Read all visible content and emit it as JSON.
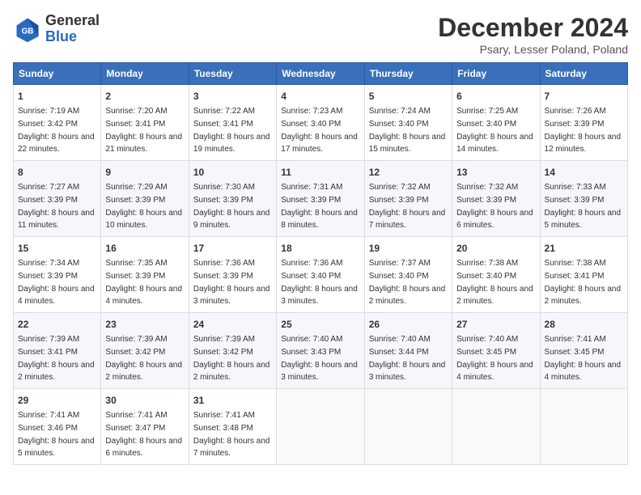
{
  "header": {
    "logo_general": "General",
    "logo_blue": "Blue",
    "month": "December 2024",
    "location": "Psary, Lesser Poland, Poland"
  },
  "weekdays": [
    "Sunday",
    "Monday",
    "Tuesday",
    "Wednesday",
    "Thursday",
    "Friday",
    "Saturday"
  ],
  "weeks": [
    [
      {
        "day": "1",
        "sunrise": "Sunrise: 7:19 AM",
        "sunset": "Sunset: 3:42 PM",
        "daylight": "Daylight: 8 hours and 22 minutes."
      },
      {
        "day": "2",
        "sunrise": "Sunrise: 7:20 AM",
        "sunset": "Sunset: 3:41 PM",
        "daylight": "Daylight: 8 hours and 21 minutes."
      },
      {
        "day": "3",
        "sunrise": "Sunrise: 7:22 AM",
        "sunset": "Sunset: 3:41 PM",
        "daylight": "Daylight: 8 hours and 19 minutes."
      },
      {
        "day": "4",
        "sunrise": "Sunrise: 7:23 AM",
        "sunset": "Sunset: 3:40 PM",
        "daylight": "Daylight: 8 hours and 17 minutes."
      },
      {
        "day": "5",
        "sunrise": "Sunrise: 7:24 AM",
        "sunset": "Sunset: 3:40 PM",
        "daylight": "Daylight: 8 hours and 15 minutes."
      },
      {
        "day": "6",
        "sunrise": "Sunrise: 7:25 AM",
        "sunset": "Sunset: 3:40 PM",
        "daylight": "Daylight: 8 hours and 14 minutes."
      },
      {
        "day": "7",
        "sunrise": "Sunrise: 7:26 AM",
        "sunset": "Sunset: 3:39 PM",
        "daylight": "Daylight: 8 hours and 12 minutes."
      }
    ],
    [
      {
        "day": "8",
        "sunrise": "Sunrise: 7:27 AM",
        "sunset": "Sunset: 3:39 PM",
        "daylight": "Daylight: 8 hours and 11 minutes."
      },
      {
        "day": "9",
        "sunrise": "Sunrise: 7:29 AM",
        "sunset": "Sunset: 3:39 PM",
        "daylight": "Daylight: 8 hours and 10 minutes."
      },
      {
        "day": "10",
        "sunrise": "Sunrise: 7:30 AM",
        "sunset": "Sunset: 3:39 PM",
        "daylight": "Daylight: 8 hours and 9 minutes."
      },
      {
        "day": "11",
        "sunrise": "Sunrise: 7:31 AM",
        "sunset": "Sunset: 3:39 PM",
        "daylight": "Daylight: 8 hours and 8 minutes."
      },
      {
        "day": "12",
        "sunrise": "Sunrise: 7:32 AM",
        "sunset": "Sunset: 3:39 PM",
        "daylight": "Daylight: 8 hours and 7 minutes."
      },
      {
        "day": "13",
        "sunrise": "Sunrise: 7:32 AM",
        "sunset": "Sunset: 3:39 PM",
        "daylight": "Daylight: 8 hours and 6 minutes."
      },
      {
        "day": "14",
        "sunrise": "Sunrise: 7:33 AM",
        "sunset": "Sunset: 3:39 PM",
        "daylight": "Daylight: 8 hours and 5 minutes."
      }
    ],
    [
      {
        "day": "15",
        "sunrise": "Sunrise: 7:34 AM",
        "sunset": "Sunset: 3:39 PM",
        "daylight": "Daylight: 8 hours and 4 minutes."
      },
      {
        "day": "16",
        "sunrise": "Sunrise: 7:35 AM",
        "sunset": "Sunset: 3:39 PM",
        "daylight": "Daylight: 8 hours and 4 minutes."
      },
      {
        "day": "17",
        "sunrise": "Sunrise: 7:36 AM",
        "sunset": "Sunset: 3:39 PM",
        "daylight": "Daylight: 8 hours and 3 minutes."
      },
      {
        "day": "18",
        "sunrise": "Sunrise: 7:36 AM",
        "sunset": "Sunset: 3:40 PM",
        "daylight": "Daylight: 8 hours and 3 minutes."
      },
      {
        "day": "19",
        "sunrise": "Sunrise: 7:37 AM",
        "sunset": "Sunset: 3:40 PM",
        "daylight": "Daylight: 8 hours and 2 minutes."
      },
      {
        "day": "20",
        "sunrise": "Sunrise: 7:38 AM",
        "sunset": "Sunset: 3:40 PM",
        "daylight": "Daylight: 8 hours and 2 minutes."
      },
      {
        "day": "21",
        "sunrise": "Sunrise: 7:38 AM",
        "sunset": "Sunset: 3:41 PM",
        "daylight": "Daylight: 8 hours and 2 minutes."
      }
    ],
    [
      {
        "day": "22",
        "sunrise": "Sunrise: 7:39 AM",
        "sunset": "Sunset: 3:41 PM",
        "daylight": "Daylight: 8 hours and 2 minutes."
      },
      {
        "day": "23",
        "sunrise": "Sunrise: 7:39 AM",
        "sunset": "Sunset: 3:42 PM",
        "daylight": "Daylight: 8 hours and 2 minutes."
      },
      {
        "day": "24",
        "sunrise": "Sunrise: 7:39 AM",
        "sunset": "Sunset: 3:42 PM",
        "daylight": "Daylight: 8 hours and 2 minutes."
      },
      {
        "day": "25",
        "sunrise": "Sunrise: 7:40 AM",
        "sunset": "Sunset: 3:43 PM",
        "daylight": "Daylight: 8 hours and 3 minutes."
      },
      {
        "day": "26",
        "sunrise": "Sunrise: 7:40 AM",
        "sunset": "Sunset: 3:44 PM",
        "daylight": "Daylight: 8 hours and 3 minutes."
      },
      {
        "day": "27",
        "sunrise": "Sunrise: 7:40 AM",
        "sunset": "Sunset: 3:45 PM",
        "daylight": "Daylight: 8 hours and 4 minutes."
      },
      {
        "day": "28",
        "sunrise": "Sunrise: 7:41 AM",
        "sunset": "Sunset: 3:45 PM",
        "daylight": "Daylight: 8 hours and 4 minutes."
      }
    ],
    [
      {
        "day": "29",
        "sunrise": "Sunrise: 7:41 AM",
        "sunset": "Sunset: 3:46 PM",
        "daylight": "Daylight: 8 hours and 5 minutes."
      },
      {
        "day": "30",
        "sunrise": "Sunrise: 7:41 AM",
        "sunset": "Sunset: 3:47 PM",
        "daylight": "Daylight: 8 hours and 6 minutes."
      },
      {
        "day": "31",
        "sunrise": "Sunrise: 7:41 AM",
        "sunset": "Sunset: 3:48 PM",
        "daylight": "Daylight: 8 hours and 7 minutes."
      },
      null,
      null,
      null,
      null
    ]
  ]
}
